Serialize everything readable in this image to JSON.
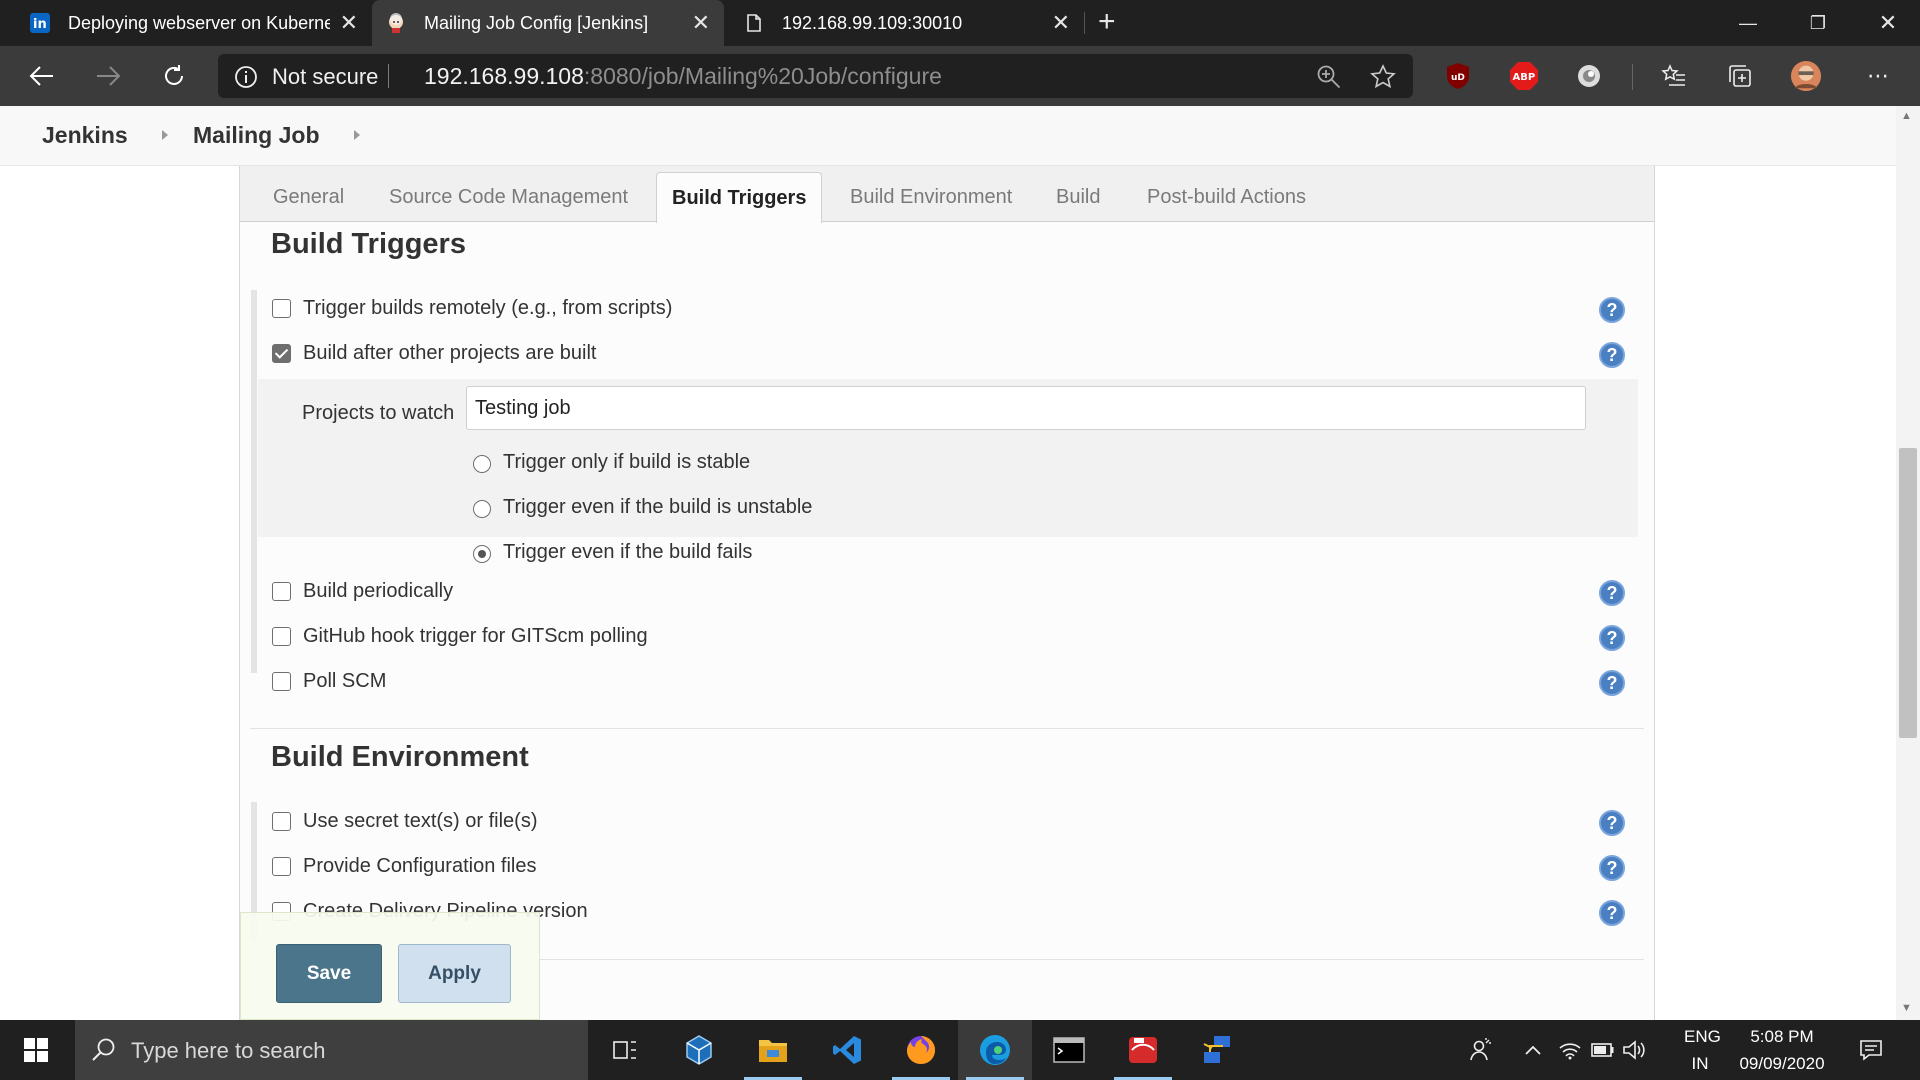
{
  "browser": {
    "tabs": [
      {
        "title": "Deploying webserver on Kuberne",
        "active": false
      },
      {
        "title": "Mailing Job Config [Jenkins]",
        "active": true
      },
      {
        "title": "192.168.99.109:30010",
        "active": false
      }
    ],
    "address": {
      "security": "Not secure",
      "host": "192.168.99.108",
      "path": ":8080/job/Mailing%20Job/configure"
    },
    "extensions": {
      "ublock": "uD",
      "adblock": "ABP"
    }
  },
  "breadcrumb": {
    "root": "Jenkins",
    "job": "Mailing Job"
  },
  "config_tabs": [
    "General",
    "Source Code Management",
    "Build Triggers",
    "Build Environment",
    "Build",
    "Post-build Actions"
  ],
  "build_triggers": {
    "heading": "Build Triggers",
    "options": [
      {
        "label": "Trigger builds remotely (e.g., from scripts)",
        "checked": false
      },
      {
        "label": "Build after other projects are built",
        "checked": true
      },
      {
        "label": "Build periodically",
        "checked": false
      },
      {
        "label": "GitHub hook trigger for GITScm polling",
        "checked": false
      },
      {
        "label": "Poll SCM",
        "checked": false
      }
    ],
    "projects_label": "Projects to watch",
    "projects_value": "Testing job",
    "radios": [
      {
        "label": "Trigger only if build is stable",
        "checked": false
      },
      {
        "label": "Trigger even if the build is unstable",
        "checked": false
      },
      {
        "label": "Trigger even if the build fails",
        "checked": true
      }
    ]
  },
  "build_environment": {
    "heading": "Build Environment",
    "options": [
      {
        "label": "Use secret text(s) or file(s)",
        "checked": false
      },
      {
        "label": "Provide Configuration files",
        "checked": false
      },
      {
        "label": "Create Delivery Pipeline version",
        "checked": false
      }
    ]
  },
  "buttons": {
    "save": "Save",
    "apply": "Apply"
  },
  "help_glyph": "?",
  "taskbar": {
    "search_placeholder": "Type here to search",
    "lang": "ENG",
    "region": "IN",
    "time": "5:08 PM",
    "date": "09/09/2020"
  },
  "colors": {
    "accent_save": "#4b758b",
    "help_icon": "#4a7fc1",
    "chrome_dark": "#202020"
  }
}
